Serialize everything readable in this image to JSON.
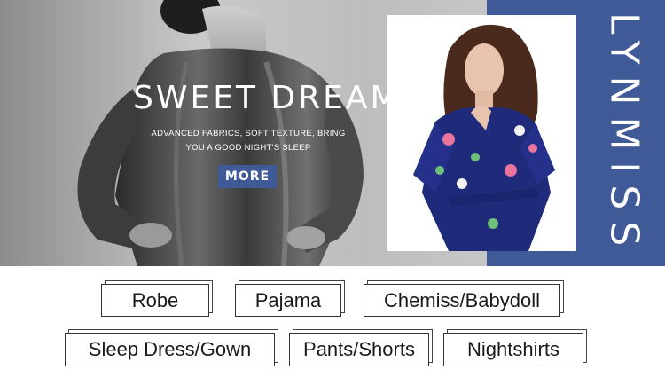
{
  "hero": {
    "headline": "SWEET DREAM",
    "subline_1": "ADVANCED FABRICS, SOFT TEXTURE, BRING",
    "subline_2": "YOU A GOOD NIGHT'S SLEEP",
    "button_label": "MORE",
    "brand": "LYNMISS",
    "colors": {
      "brand_blue": "#3f5a97",
      "background_grey": "#bdbdbd"
    }
  },
  "categories": [
    {
      "label": "Robe"
    },
    {
      "label": "Pajama"
    },
    {
      "label": "Chemiss/Babydoll"
    },
    {
      "label": "Sleep Dress/Gown"
    },
    {
      "label": "Pants/Shorts"
    },
    {
      "label": "Nightshirts"
    }
  ]
}
